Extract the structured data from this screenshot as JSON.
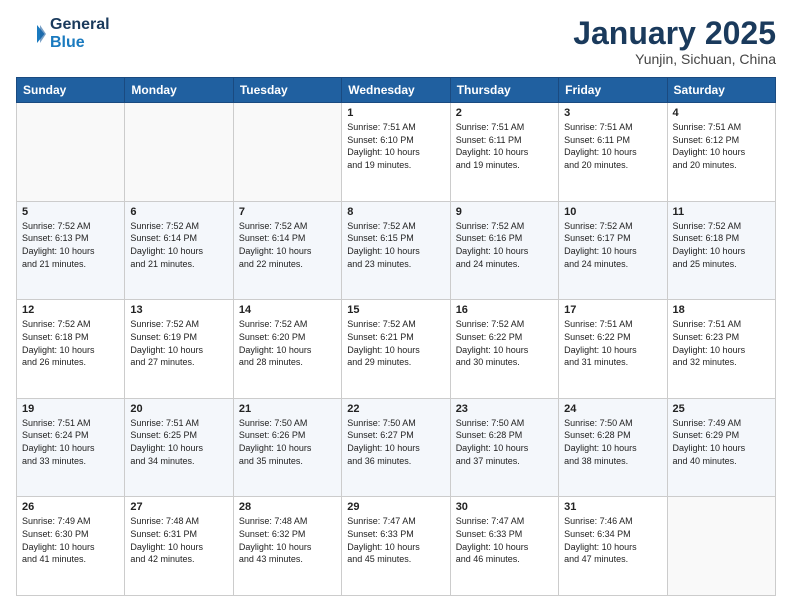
{
  "header": {
    "logo_general": "General",
    "logo_blue": "Blue",
    "month_title": "January 2025",
    "location": "Yunjin, Sichuan, China"
  },
  "weekdays": [
    "Sunday",
    "Monday",
    "Tuesday",
    "Wednesday",
    "Thursday",
    "Friday",
    "Saturday"
  ],
  "weeks": [
    [
      {
        "day": "",
        "info": ""
      },
      {
        "day": "",
        "info": ""
      },
      {
        "day": "",
        "info": ""
      },
      {
        "day": "1",
        "info": "Sunrise: 7:51 AM\nSunset: 6:10 PM\nDaylight: 10 hours\nand 19 minutes."
      },
      {
        "day": "2",
        "info": "Sunrise: 7:51 AM\nSunset: 6:11 PM\nDaylight: 10 hours\nand 19 minutes."
      },
      {
        "day": "3",
        "info": "Sunrise: 7:51 AM\nSunset: 6:11 PM\nDaylight: 10 hours\nand 20 minutes."
      },
      {
        "day": "4",
        "info": "Sunrise: 7:51 AM\nSunset: 6:12 PM\nDaylight: 10 hours\nand 20 minutes."
      }
    ],
    [
      {
        "day": "5",
        "info": "Sunrise: 7:52 AM\nSunset: 6:13 PM\nDaylight: 10 hours\nand 21 minutes."
      },
      {
        "day": "6",
        "info": "Sunrise: 7:52 AM\nSunset: 6:14 PM\nDaylight: 10 hours\nand 21 minutes."
      },
      {
        "day": "7",
        "info": "Sunrise: 7:52 AM\nSunset: 6:14 PM\nDaylight: 10 hours\nand 22 minutes."
      },
      {
        "day": "8",
        "info": "Sunrise: 7:52 AM\nSunset: 6:15 PM\nDaylight: 10 hours\nand 23 minutes."
      },
      {
        "day": "9",
        "info": "Sunrise: 7:52 AM\nSunset: 6:16 PM\nDaylight: 10 hours\nand 24 minutes."
      },
      {
        "day": "10",
        "info": "Sunrise: 7:52 AM\nSunset: 6:17 PM\nDaylight: 10 hours\nand 24 minutes."
      },
      {
        "day": "11",
        "info": "Sunrise: 7:52 AM\nSunset: 6:18 PM\nDaylight: 10 hours\nand 25 minutes."
      }
    ],
    [
      {
        "day": "12",
        "info": "Sunrise: 7:52 AM\nSunset: 6:18 PM\nDaylight: 10 hours\nand 26 minutes."
      },
      {
        "day": "13",
        "info": "Sunrise: 7:52 AM\nSunset: 6:19 PM\nDaylight: 10 hours\nand 27 minutes."
      },
      {
        "day": "14",
        "info": "Sunrise: 7:52 AM\nSunset: 6:20 PM\nDaylight: 10 hours\nand 28 minutes."
      },
      {
        "day": "15",
        "info": "Sunrise: 7:52 AM\nSunset: 6:21 PM\nDaylight: 10 hours\nand 29 minutes."
      },
      {
        "day": "16",
        "info": "Sunrise: 7:52 AM\nSunset: 6:22 PM\nDaylight: 10 hours\nand 30 minutes."
      },
      {
        "day": "17",
        "info": "Sunrise: 7:51 AM\nSunset: 6:22 PM\nDaylight: 10 hours\nand 31 minutes."
      },
      {
        "day": "18",
        "info": "Sunrise: 7:51 AM\nSunset: 6:23 PM\nDaylight: 10 hours\nand 32 minutes."
      }
    ],
    [
      {
        "day": "19",
        "info": "Sunrise: 7:51 AM\nSunset: 6:24 PM\nDaylight: 10 hours\nand 33 minutes."
      },
      {
        "day": "20",
        "info": "Sunrise: 7:51 AM\nSunset: 6:25 PM\nDaylight: 10 hours\nand 34 minutes."
      },
      {
        "day": "21",
        "info": "Sunrise: 7:50 AM\nSunset: 6:26 PM\nDaylight: 10 hours\nand 35 minutes."
      },
      {
        "day": "22",
        "info": "Sunrise: 7:50 AM\nSunset: 6:27 PM\nDaylight: 10 hours\nand 36 minutes."
      },
      {
        "day": "23",
        "info": "Sunrise: 7:50 AM\nSunset: 6:28 PM\nDaylight: 10 hours\nand 37 minutes."
      },
      {
        "day": "24",
        "info": "Sunrise: 7:50 AM\nSunset: 6:28 PM\nDaylight: 10 hours\nand 38 minutes."
      },
      {
        "day": "25",
        "info": "Sunrise: 7:49 AM\nSunset: 6:29 PM\nDaylight: 10 hours\nand 40 minutes."
      }
    ],
    [
      {
        "day": "26",
        "info": "Sunrise: 7:49 AM\nSunset: 6:30 PM\nDaylight: 10 hours\nand 41 minutes."
      },
      {
        "day": "27",
        "info": "Sunrise: 7:48 AM\nSunset: 6:31 PM\nDaylight: 10 hours\nand 42 minutes."
      },
      {
        "day": "28",
        "info": "Sunrise: 7:48 AM\nSunset: 6:32 PM\nDaylight: 10 hours\nand 43 minutes."
      },
      {
        "day": "29",
        "info": "Sunrise: 7:47 AM\nSunset: 6:33 PM\nDaylight: 10 hours\nand 45 minutes."
      },
      {
        "day": "30",
        "info": "Sunrise: 7:47 AM\nSunset: 6:33 PM\nDaylight: 10 hours\nand 46 minutes."
      },
      {
        "day": "31",
        "info": "Sunrise: 7:46 AM\nSunset: 6:34 PM\nDaylight: 10 hours\nand 47 minutes."
      },
      {
        "day": "",
        "info": ""
      }
    ]
  ]
}
